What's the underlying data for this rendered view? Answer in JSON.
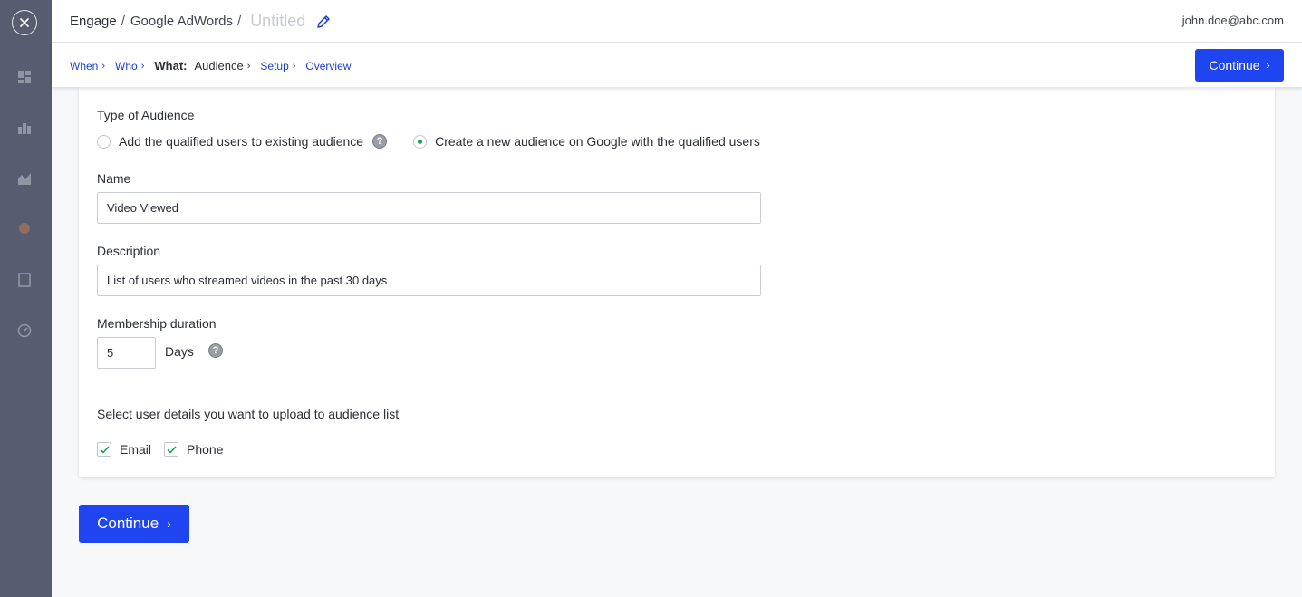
{
  "header": {
    "breadcrumb": [
      "Engage",
      "Google AdWords"
    ],
    "separator": "/",
    "campaign_title": "Untitled",
    "user_email": "john.doe@abc.com"
  },
  "steps": {
    "items": [
      "When",
      "Who"
    ],
    "group_label": "What:",
    "current": "Audience",
    "after": [
      "Setup",
      "Overview"
    ],
    "chevron": "›",
    "continue_label": "Continue"
  },
  "form": {
    "type_label": "Type of Audience",
    "option_existing": "Add the qualified users to existing audience",
    "option_new": "Create a new audience on Google with the qualified users",
    "selected": "new",
    "help": "?",
    "name_label": "Name",
    "name_value": "Video Viewed",
    "description_label": "Description",
    "description_value": "List of users who streamed videos in the past 30 days",
    "duration_label": "Membership duration",
    "duration_value": "5",
    "duration_unit": "Days",
    "details_label": "Select user details you want to upload to audience list",
    "details": [
      {
        "label": "Email",
        "checked": true
      },
      {
        "label": "Phone",
        "checked": true
      }
    ]
  },
  "footer": {
    "continue_label": "Continue",
    "chevron": "›"
  },
  "colors": {
    "sidebar": "#585c70",
    "primary": "#1f45f0",
    "link": "#1a3fd9",
    "check": "#16a34a"
  },
  "icons": {
    "close": "close-icon",
    "edit": "pencil-icon",
    "help": "question-icon",
    "check": "check-icon"
  }
}
